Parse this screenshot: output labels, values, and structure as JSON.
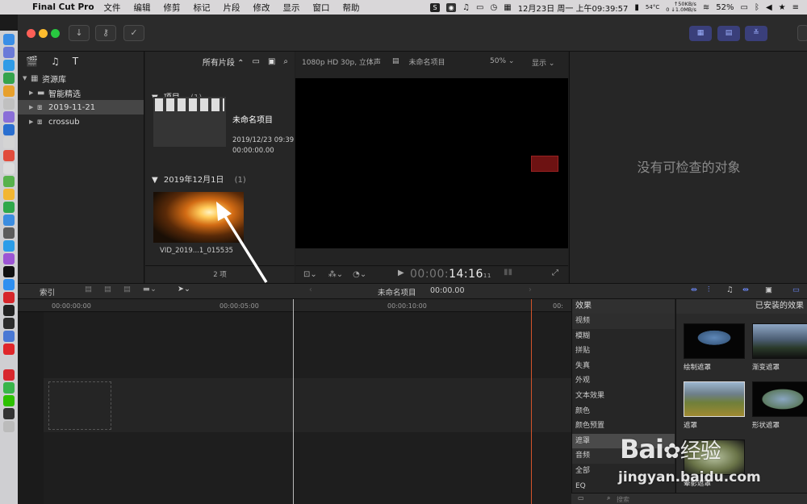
{
  "menubar": {
    "app_name": "Final Cut Pro",
    "items": [
      "文件",
      "编辑",
      "修剪",
      "标记",
      "片段",
      "修改",
      "显示",
      "窗口",
      "帮助"
    ],
    "status": {
      "temperature": "54°C",
      "net_up": "↑50KB/s",
      "net_down": "0 ↓1.0MB/s",
      "datetime": "12月23日 周一 上午09:39:57",
      "battery": "52%"
    }
  },
  "library": {
    "root_label": "资源库",
    "items": [
      {
        "label": "智能精选",
        "icon": "folder-icon"
      },
      {
        "label": "2019-11-21",
        "icon": "event-icon",
        "selected": true
      },
      {
        "label": "crossub",
        "icon": "event-icon"
      }
    ]
  },
  "browser": {
    "filter_label": "所有片段",
    "projects_header": "项目",
    "projects_count": "(1)",
    "project_name": "未命名项目",
    "project_date": "2019/12/23 09:39",
    "project_duration": "00:00:00.00",
    "event_header": "2019年12月1日",
    "event_count": "(1)",
    "clip_name": "VID_2019...1_015535",
    "footer": "2 项"
  },
  "viewer": {
    "format": "1080p HD 30p, 立体声",
    "project": "未命名项目",
    "zoom": "50%",
    "display_menu": "显示",
    "timecode_dim": "00:00:",
    "timecode_main": "14:16",
    "timecode_frames": "11"
  },
  "inspector": {
    "empty_message": "没有可检查的对象"
  },
  "timeline": {
    "index_label": "索引",
    "project_name": "未命名项目",
    "project_time": "00:00.00",
    "ruler": [
      "00:00:00:00",
      "00:00:05:00",
      "00:00:10:00",
      "00:"
    ]
  },
  "effects": {
    "header": "效果",
    "installed_header": "已安装的效果",
    "categories": [
      "视频",
      "模糊",
      "拼贴",
      "失真",
      "外观",
      "文本效果",
      "颜色",
      "颜色预置",
      "遮罩",
      "音频",
      "全部",
      "EQ"
    ],
    "selected_category": "遮罩",
    "items": [
      {
        "label": "绘制遮罩"
      },
      {
        "label": "渐变遮罩"
      },
      {
        "label": "遮罩"
      },
      {
        "label": "形状遮罩"
      },
      {
        "label": "晕影遮罩"
      }
    ],
    "search_placeholder": "搜索"
  },
  "watermark": {
    "brand_left": "Bai",
    "brand_right": "经验",
    "url": "jingyan.baidu.com"
  },
  "colors": {
    "accent": "#6f8cff",
    "skimmer": "#d2542a"
  }
}
